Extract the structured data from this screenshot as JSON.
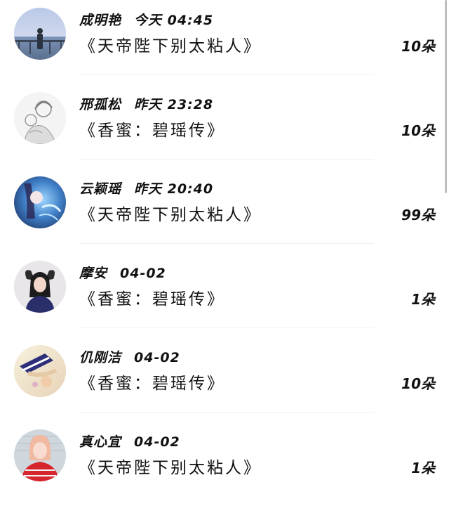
{
  "rows": [
    {
      "name": "成明艳",
      "time": "今天 04:45",
      "book": "《天帝陛下别太粘人》",
      "count": "10朵",
      "avatar": "seaside-photo"
    },
    {
      "name": "邢孤松",
      "time": "昨天 23:28",
      "book": "《香蜜：碧瑶传》",
      "count": "10朵",
      "avatar": "sketch-illustration"
    },
    {
      "name": "云颖瑶",
      "time": "昨天 20:40",
      "book": "《天帝陛下别太粘人》",
      "count": "99朵",
      "avatar": "anime-girl"
    },
    {
      "name": "摩安",
      "time": "04-02",
      "book": "《香蜜：碧瑶传》",
      "count": "1朵",
      "avatar": "girl-portrait"
    },
    {
      "name": "仉刚洁",
      "time": "04-02",
      "book": "《香蜜：碧瑶传》",
      "count": "10朵",
      "avatar": "hat-photo"
    },
    {
      "name": "真心宜",
      "time": "04-02",
      "book": "《天帝陛下别太粘人》",
      "count": "1朵",
      "avatar": "red-sweater-girl"
    }
  ]
}
